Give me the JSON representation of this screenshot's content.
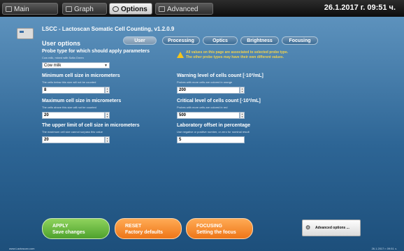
{
  "tabs": [
    {
      "label": "Main",
      "icon": "window-icon"
    },
    {
      "label": "Graph",
      "icon": "graph-icon"
    },
    {
      "label": "Options",
      "icon": "gear-icon"
    },
    {
      "label": "Advanced",
      "icon": "window-icon"
    }
  ],
  "datetime": "26.1.2017 г. 09:51 ч.",
  "app_title": "LSCC - Lactoscan Somatic Cell Counting, v1.2.0.9",
  "section_title": "User options",
  "subtabs": [
    "User",
    "Processing",
    "Optics",
    "Brightness",
    "Focusing"
  ],
  "probe": {
    "label": "Probe type for which should apply parameters",
    "hint": "Cow milk, mixed with Sofia Green",
    "value": "Cow milk"
  },
  "min_cell": {
    "label": "Minimum cell size in micrometers",
    "hint": "The cells below this size will not be counted",
    "value": "8"
  },
  "max_cell": {
    "label": "Maximum cell size in micrometers",
    "hint": "The cells above this size will not be counted",
    "value": "20"
  },
  "upper_limit": {
    "label": "The upper limit of cell size in micrometers",
    "hint": "The maximum cell size cannot surpass this value",
    "value": "20"
  },
  "warning": {
    "line1": "All values on this page are associated to selected probe type.",
    "line2": "The other probe types may have their own different values."
  },
  "warn_level": {
    "label": "Warning level of cells count [·10³/mL]",
    "hint": "Probes with more cells are colored in orange",
    "value": "200"
  },
  "critical_level": {
    "label": "Critical level of cells count [·10³/mL]",
    "hint": "Probes with more cells are colored in red",
    "value": "500"
  },
  "lab_offset": {
    "label": "Laboratory offset in percentage",
    "hint": "Use negative or positive number, or zero for nominal result",
    "value": "5"
  },
  "buttons": {
    "apply_1": "APPLY",
    "apply_2": "Save changes",
    "reset_1": "RESET",
    "reset_2": "Factory defaults",
    "focusing_1": "FOCUSING",
    "focusing_2": "Setting the focus",
    "advanced": "Advanced options ..."
  },
  "footer": {
    "url": "www.Lactoscan.com",
    "date": "26.1.2017 г. 09:51 ч."
  }
}
